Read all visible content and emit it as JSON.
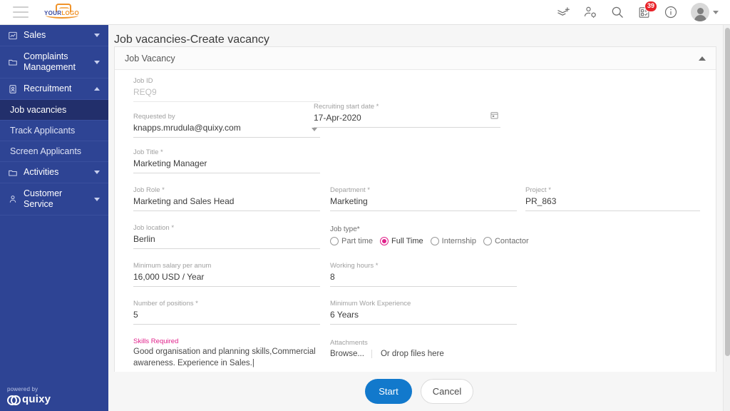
{
  "topbar": {
    "menu_icon": "hamburger-icon",
    "logo": {
      "text_primary": "YOUR",
      "text_secondary": "LOGO"
    },
    "icons": [
      {
        "name": "add-layers-icon",
        "label": "Add Layers"
      },
      {
        "name": "user-settings-icon",
        "label": "User Settings"
      },
      {
        "name": "search-icon",
        "label": "Search"
      },
      {
        "name": "tasks-icon",
        "label": "Tasks",
        "badge": "39"
      },
      {
        "name": "info-icon",
        "label": "Info"
      }
    ],
    "avatar": {
      "name": "avatar",
      "chevron": "chevron-down-icon"
    }
  },
  "sidebar": {
    "groups": [
      {
        "label": "Sales",
        "icon": "chart-icon",
        "expanded": false
      },
      {
        "label": "Complaints Management",
        "icon": "folder-icon",
        "expanded": false
      },
      {
        "label": "Recruitment",
        "icon": "id-badge-icon",
        "expanded": true
      },
      {
        "label": "Activities",
        "icon": "folder-icon",
        "expanded": false
      },
      {
        "label": "Customer Service",
        "icon": "person-icon",
        "expanded": false
      }
    ],
    "recruitment_items": [
      {
        "label": "Job vacancies",
        "active": true
      },
      {
        "label": "Track Applicants",
        "active": false
      },
      {
        "label": "Screen Applicants",
        "active": false
      }
    ],
    "powered_by": {
      "prefix": "powered by",
      "brand": "quixy"
    }
  },
  "page": {
    "title": "Job vacancies-Create vacancy",
    "card_title": "Job Vacancy",
    "collapse_icon": "chevron-up-icon"
  },
  "form": {
    "job_id": {
      "label": "Job ID",
      "value": "REQ9"
    },
    "requested_by": {
      "label": "Requested by",
      "value": "knapps.mrudula@quixy.com"
    },
    "recruiting_start_date": {
      "label": "Recruiting start date *",
      "value": "17-Apr-2020",
      "icon": "calendar-icon"
    },
    "job_title": {
      "label": "Job Title *",
      "value": "Marketing Manager"
    },
    "job_role": {
      "label": "Job Role *",
      "value": "Marketing and Sales Head"
    },
    "department": {
      "label": "Department *",
      "value": "Marketing"
    },
    "project": {
      "label": "Project *",
      "value": "PR_863"
    },
    "job_location": {
      "label": "Job location *",
      "value": "Berlin"
    },
    "job_type": {
      "label": "Job type*",
      "options": [
        {
          "label": "Part time",
          "selected": false
        },
        {
          "label": "Full Time",
          "selected": true
        },
        {
          "label": "Internship",
          "selected": false
        },
        {
          "label": "Contactor",
          "selected": false
        }
      ]
    },
    "minimum_salary": {
      "label": "Minimum salary per anum",
      "value": "16,000 USD / Year"
    },
    "working_hours": {
      "label": "Working hours *",
      "value": "8"
    },
    "number_of_positions": {
      "label": "Number of positions *",
      "value": "5"
    },
    "minimum_work_experience": {
      "label": "Minimum Work Experience",
      "value": "6 Years"
    },
    "skills_required": {
      "label": "Skills Required",
      "value": "Good organisation and planning skills,Commercial awareness. Experience in Sales.|"
    },
    "attachments": {
      "label": "Attachments",
      "browse": "Browse...",
      "drop_hint": "Or drop files here"
    }
  },
  "footer": {
    "start_label": "Start",
    "cancel_label": "Cancel"
  },
  "colors": {
    "sidebar_bg": "#2e4494",
    "sidebar_active": "#222f6b",
    "accent_pink": "#e0218a",
    "primary_blue": "#1279cc",
    "badge_red": "#e8232a",
    "logo_orange": "#f0932a"
  }
}
